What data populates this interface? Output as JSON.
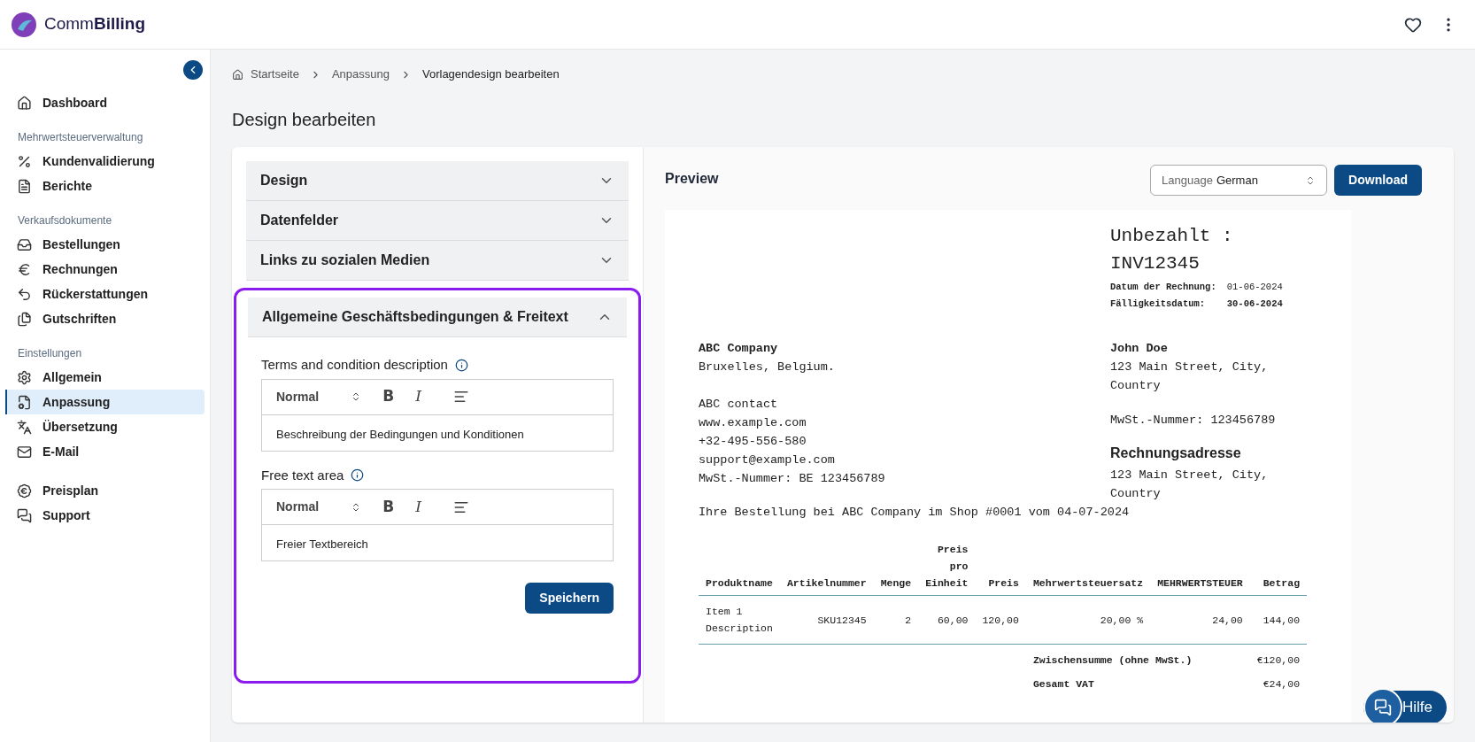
{
  "app": {
    "logo_text_light": "Comm",
    "logo_text_bold": "Billing"
  },
  "sidebar": {
    "sections": [
      {
        "items": [
          {
            "label": "Dashboard",
            "selected": false
          }
        ]
      },
      {
        "label": "Mehrwertsteuerverwaltung",
        "items": [
          {
            "label": "Kundenvalidierung",
            "selected": false
          },
          {
            "label": "Berichte",
            "selected": false
          }
        ]
      },
      {
        "label": "Verkaufsdokumente",
        "items": [
          {
            "label": "Bestellungen",
            "selected": false
          },
          {
            "label": "Rechnungen",
            "selected": false
          },
          {
            "label": "Rückerstattungen",
            "selected": false
          },
          {
            "label": "Gutschriften",
            "selected": false
          }
        ]
      },
      {
        "label": "Einstellungen",
        "items": [
          {
            "label": "Allgemein",
            "selected": false
          },
          {
            "label": "Anpassung",
            "selected": true
          },
          {
            "label": "Übersetzung",
            "selected": false
          },
          {
            "label": "E-Mail",
            "selected": false
          }
        ]
      },
      {
        "items": [
          {
            "label": "Preisplan",
            "selected": false
          },
          {
            "label": "Support",
            "selected": false
          }
        ]
      }
    ]
  },
  "breadcrumb": [
    "Startseite",
    "Anpassung",
    "Vorlagendesign bearbeiten"
  ],
  "page_title": "Design bearbeiten",
  "accordion": [
    {
      "title": "Design",
      "expanded": false
    },
    {
      "title": "Datenfelder",
      "expanded": false
    },
    {
      "title": "Links zu sozialen Medien",
      "expanded": false
    },
    {
      "title": "Allgemeine Geschäftsbedingungen & Freitext",
      "expanded": true,
      "highlighted": true,
      "fields": [
        {
          "label": "Terms and condition description",
          "format": "Normal",
          "bold": "B",
          "italic": "I",
          "value": "Beschreibung der Bedingungen und Konditionen"
        },
        {
          "label": "Free text area",
          "format": "Normal",
          "bold": "B",
          "italic": "I",
          "value": "Freier Textbereich"
        }
      ],
      "save_button": "Speichern"
    }
  ],
  "preview": {
    "title": "Preview",
    "language_label": "Language",
    "language_value": "German",
    "download_button": "Download",
    "invoice": {
      "status_title": "Unbezahlt : INV12345",
      "dates": [
        {
          "label": "Datum der Rechnung:",
          "value": "01-06-2024",
          "bold": false
        },
        {
          "label": "Fälligkeitsdatum:",
          "value": "30-06-2024",
          "bold": true
        }
      ],
      "seller": {
        "name": "ABC Company",
        "address": "Bruxelles, Belgium.",
        "lines": [
          "ABC contact",
          "www.example.com",
          "+32-495-556-580",
          "support@example.com",
          "MwSt.-Nummer: BE 123456789"
        ]
      },
      "buyer": {
        "name": "John Doe",
        "address": "123 Main Street, City, Country",
        "vat": "MwSt.-Nummer: 123456789",
        "billing_title": "Rechnungsadresse",
        "billing_address": "123 Main Street, City, Country"
      },
      "order_line": "Ihre Bestellung bei ABC Company im Shop #0001 vom 04-07-2024",
      "columns": [
        "Produktname",
        "Artikelnummer",
        "Menge",
        "Preis pro Einheit",
        "Preis",
        "Mehrwertsteuersatz",
        "MEHRWERTSTEUER",
        "Betrag"
      ],
      "rows": [
        [
          "Item 1 Description",
          "SKU12345",
          "2",
          "60,00",
          "120,00",
          "20,00 %",
          "24,00",
          "144,00"
        ]
      ],
      "totals": [
        {
          "label": "Zwischensumme (ohne MwSt.)",
          "value": "€120,00"
        },
        {
          "label": "Gesamt VAT",
          "value": "€24,00"
        }
      ]
    }
  },
  "help_button": "Hilfe"
}
